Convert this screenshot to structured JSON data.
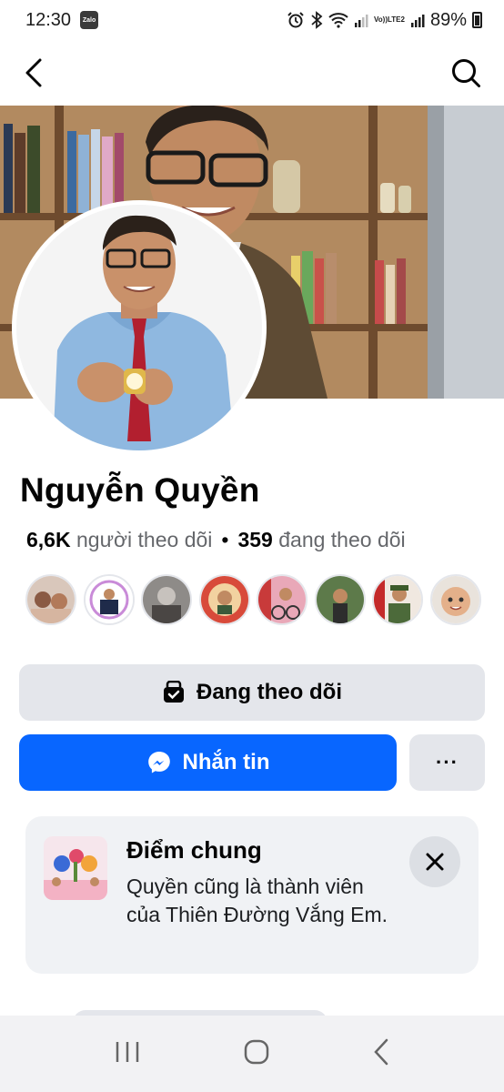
{
  "status_bar": {
    "time": "12:30",
    "zalo_label": "Zalo",
    "network_label_top": "Vo))",
    "network_label_bottom": "LTE2",
    "battery": "89%"
  },
  "nav": {
    "back_icon": "arrow-left-icon",
    "search_icon": "search-icon"
  },
  "profile": {
    "name": "Nguyễn Quyền",
    "followers_count": "6,6K",
    "followers_label": "người theo dõi",
    "separator": "•",
    "following_count": "359",
    "following_label": "đang theo dõi",
    "mutual_friend_avatars": 8
  },
  "actions": {
    "following_label": "Đang theo dõi",
    "message_label": "Nhắn tin",
    "more_label": "···"
  },
  "in_common": {
    "title": "Điểm chung",
    "description": "Quyền cũng là thành viên của Thiên Đường Vắng Em."
  },
  "colors": {
    "accent": "#0866ff",
    "secondary_button": "#e4e6eb",
    "card_bg": "#f0f2f5"
  }
}
